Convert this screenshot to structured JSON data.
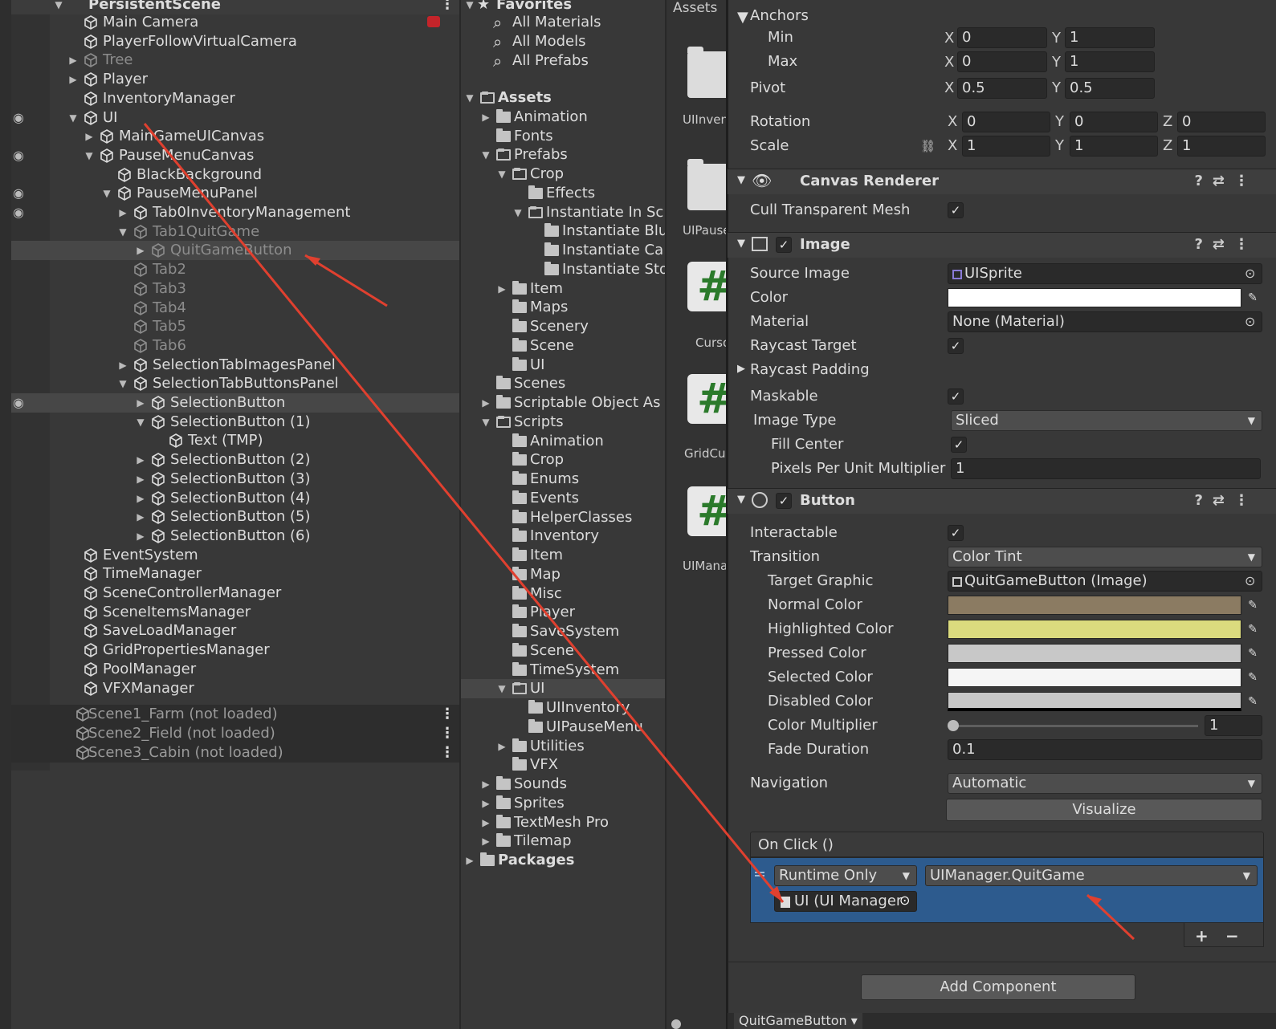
{
  "hierarchy": {
    "root": "PersistentScene",
    "items": [
      {
        "label": "Main Camera"
      },
      {
        "label": "PlayerFollowVirtualCamera"
      },
      {
        "label": "Tree"
      },
      {
        "label": "Player"
      },
      {
        "label": "InventoryManager"
      },
      {
        "label": "UI"
      },
      {
        "label": "MainGameUICanvas"
      },
      {
        "label": "PauseMenuCanvas"
      },
      {
        "label": "BlackBackground"
      },
      {
        "label": "PauseMenuPanel"
      },
      {
        "label": "Tab0InventoryManagement"
      },
      {
        "label": "Tab1QuitGame"
      },
      {
        "label": "QuitGameButton"
      },
      {
        "label": "Tab2"
      },
      {
        "label": "Tab3"
      },
      {
        "label": "Tab4"
      },
      {
        "label": "Tab5"
      },
      {
        "label": "Tab6"
      },
      {
        "label": "SelectionTabImagesPanel"
      },
      {
        "label": "SelectionTabButtonsPanel"
      },
      {
        "label": "SelectionButton"
      },
      {
        "label": "SelectionButton (1)"
      },
      {
        "label": "Text (TMP)"
      },
      {
        "label": "SelectionButton (2)"
      },
      {
        "label": "SelectionButton (3)"
      },
      {
        "label": "SelectionButton (4)"
      },
      {
        "label": "SelectionButton (5)"
      },
      {
        "label": "SelectionButton (6)"
      },
      {
        "label": "EventSystem"
      },
      {
        "label": "TimeManager"
      },
      {
        "label": "SceneControllerManager"
      },
      {
        "label": "SceneItemsManager"
      },
      {
        "label": "SaveLoadManager"
      },
      {
        "label": "GridPropertiesManager"
      },
      {
        "label": "PoolManager"
      },
      {
        "label": "VFXManager"
      }
    ],
    "scenes": [
      "Scene1_Farm (not loaded)",
      "Scene2_Field (not loaded)",
      "Scene3_Cabin (not loaded)"
    ]
  },
  "project": {
    "favorites_label": "Favorites",
    "favorites": [
      "All Materials",
      "All Models",
      "All Prefabs"
    ],
    "items": [
      {
        "label": "Assets"
      },
      {
        "label": "Animation"
      },
      {
        "label": "Fonts"
      },
      {
        "label": "Prefabs"
      },
      {
        "label": "Crop"
      },
      {
        "label": "Effects"
      },
      {
        "label": "Instantiate In Sc"
      },
      {
        "label": "Instantiate Blu"
      },
      {
        "label": "Instantiate Ca"
      },
      {
        "label": "Instantiate Sto"
      },
      {
        "label": "Item"
      },
      {
        "label": "Maps"
      },
      {
        "label": "Scenery"
      },
      {
        "label": "Scene"
      },
      {
        "label": "UI"
      },
      {
        "label": "Scenes"
      },
      {
        "label": "Scriptable Object As"
      },
      {
        "label": "Scripts"
      },
      {
        "label": "Animation"
      },
      {
        "label": "Crop"
      },
      {
        "label": "Enums"
      },
      {
        "label": "Events"
      },
      {
        "label": "HelperClasses"
      },
      {
        "label": "Inventory"
      },
      {
        "label": "Item"
      },
      {
        "label": "Map"
      },
      {
        "label": "Misc"
      },
      {
        "label": "Player"
      },
      {
        "label": "SaveSystem"
      },
      {
        "label": "Scene"
      },
      {
        "label": "TimeSystem"
      },
      {
        "label": "UI"
      },
      {
        "label": "UIInventory"
      },
      {
        "label": "UIPauseMenu"
      },
      {
        "label": "Utilities"
      },
      {
        "label": "VFX"
      },
      {
        "label": "Sounds"
      },
      {
        "label": "Sprites"
      },
      {
        "label": "TextMesh Pro"
      },
      {
        "label": "Tilemap"
      },
      {
        "label": "Packages"
      }
    ]
  },
  "assets": {
    "header": "Assets",
    "tiles": [
      "UIInven",
      "UIPause",
      "Curso",
      "GridCur",
      "UIMana"
    ]
  },
  "inspector": {
    "rect": {
      "anchors": "Anchors",
      "min": "Min",
      "max": "Max",
      "pivot": "Pivot",
      "rotation": "Rotation",
      "scale": "Scale",
      "min_x": "0",
      "min_y": "1",
      "max_x": "0",
      "max_y": "1",
      "pivot_x": "0.5",
      "pivot_y": "0.5",
      "rot_x": "0",
      "rot_y": "0",
      "rot_z": "0",
      "scale_x": "1",
      "scale_y": "1",
      "scale_z": "1",
      "x": "X",
      "y": "Y",
      "z": "Z"
    },
    "canvas_renderer": {
      "title": "Canvas Renderer",
      "cull_label": "Cull Transparent Mesh"
    },
    "image": {
      "title": "Image",
      "source_image_label": "Source Image",
      "source_image": "UISprite",
      "color_label": "Color",
      "color": "#ffffff",
      "material_label": "Material",
      "material": "None (Material)",
      "raycast_target_label": "Raycast Target",
      "raycast_padding_label": "Raycast Padding",
      "maskable_label": "Maskable",
      "image_type_label": "Image Type",
      "image_type": "Sliced",
      "fill_center_label": "Fill Center",
      "ppu_label": "Pixels Per Unit Multiplier",
      "ppu": "1"
    },
    "button": {
      "title": "Button",
      "interactable_label": "Interactable",
      "transition_label": "Transition",
      "transition": "Color Tint",
      "target_graphic_label": "Target Graphic",
      "target_graphic": "QuitGameButton (Image)",
      "normal_label": "Normal Color",
      "normal": "#8b7b62",
      "highlighted_label": "Highlighted Color",
      "highlighted": "#dbdb7e",
      "pressed_label": "Pressed Color",
      "pressed": "#c8c8c8",
      "selected_label": "Selected Color",
      "selected": "#f5f5f5",
      "disabled_label": "Disabled Color",
      "disabled": "#c8c8c8",
      "multiplier_label": "Color Multiplier",
      "multiplier": "1",
      "fade_label": "Fade Duration",
      "fade": "0.1",
      "navigation_label": "Navigation",
      "navigation": "Automatic",
      "visualize": "Visualize",
      "onclick_label": "On Click ()",
      "runtime": "Runtime Only",
      "method": "UIManager.QuitGame",
      "target_object": "UI (UI Manager",
      "add": "+",
      "remove": "−"
    },
    "add_component": "Add Component",
    "footer_tab": "QuitGameButton ▾"
  },
  "annotation_color": "#e0402f"
}
